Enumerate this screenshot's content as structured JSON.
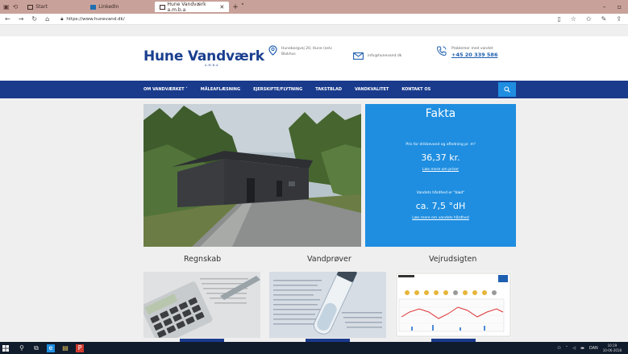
{
  "browser": {
    "tabs": [
      {
        "label": "Start"
      },
      {
        "label": "LinkedIn"
      },
      {
        "label": "Hune Vandværk a.m.b.a"
      }
    ],
    "url": "https://www.hunevand.dk/"
  },
  "header": {
    "logo": "Hune Vandværk",
    "logo_sub": "A.M.B.A",
    "address_line1": "Huneborgvej 20, Hune (selv",
    "address_line2": "Blokhus",
    "email": "info@hunevand.dk",
    "phone_label": "Problemer med vandet",
    "phone": "+45 20 339 586"
  },
  "nav": {
    "items": [
      "OM VANDVÆRKET ˅",
      "MÅLEAFLÆSNING",
      "EJERSKIFTE/FLYTNING",
      "TAKSTBLAD",
      "VANDKVALITET",
      "KONTAKT OS"
    ],
    "search_icon": "search-icon"
  },
  "fakta": {
    "title": "Fakta",
    "price_label": "Pris for  drikkevand og afledning pr. m³",
    "price_value": "36,37 kr.",
    "price_link": "Læs mere om priser",
    "hardness_label": "Vandets hårdhed er \"blød\"",
    "hardness_value": "ca. 7,5 °dH",
    "hardness_link": "Læs mere om vandets hårdhed"
  },
  "columns": [
    {
      "title": "Regnskab"
    },
    {
      "title": "Vandprøver"
    },
    {
      "title": "Vejrudsigten"
    }
  ],
  "taskbar": {
    "lang": "DAN",
    "time": "10:19",
    "date": "10-06-2018"
  }
}
